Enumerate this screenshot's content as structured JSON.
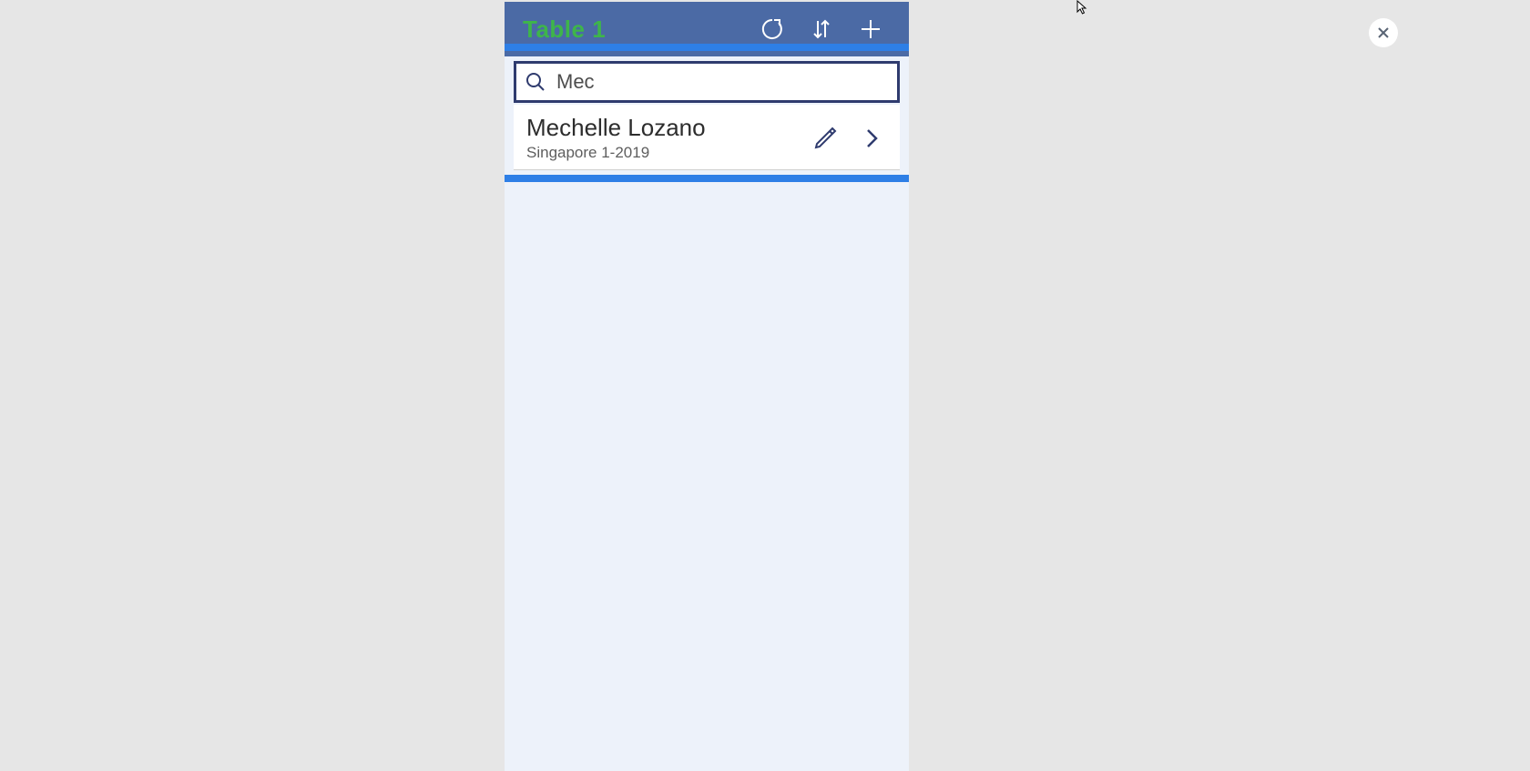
{
  "header": {
    "title": "Table 1"
  },
  "search": {
    "value": "Mec"
  },
  "results": [
    {
      "name": "Mechelle Lozano",
      "subtitle": "Singapore 1-2019"
    }
  ]
}
